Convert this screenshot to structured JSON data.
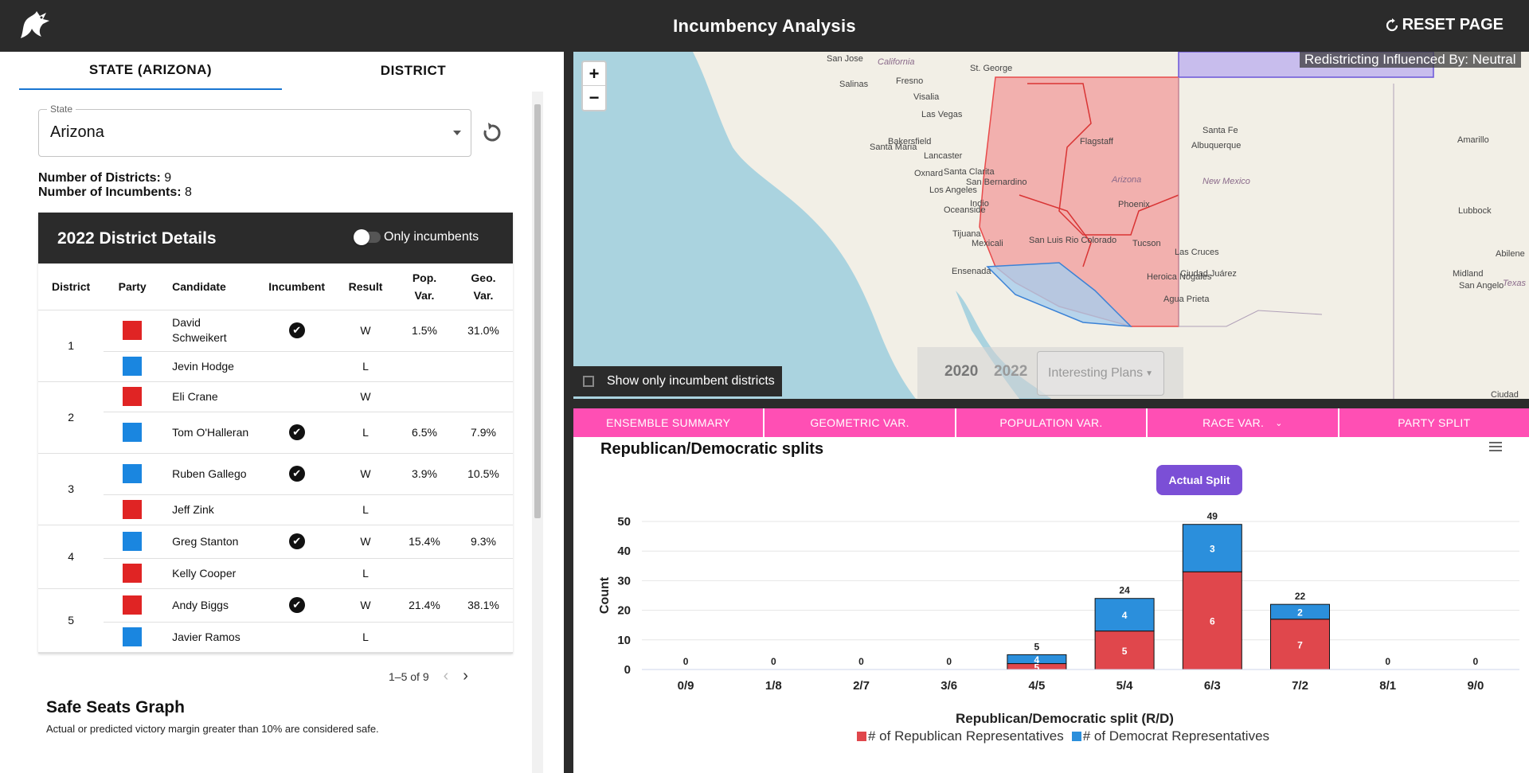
{
  "app": {
    "title": "Incumbency Analysis",
    "reset_label": "RESET PAGE"
  },
  "tabs": [
    {
      "label": "STATE (ARIZONA)",
      "active": true
    },
    {
      "label": "DISTRICT",
      "active": false
    }
  ],
  "state_select": {
    "legend": "State",
    "value": "Arizona"
  },
  "counts": {
    "districts_label": "Number of Districts:",
    "districts_value": "9",
    "incumbents_label": "Number of Incumbents:",
    "incumbents_value": "8"
  },
  "details": {
    "title": "2022 District Details",
    "toggle_label": "Only incumbents",
    "toggle_on": false,
    "columns": [
      "District",
      "Party",
      "Candidate",
      "Incumbent",
      "Result",
      "Pop. Var.",
      "Geo. Var."
    ],
    "rows": [
      {
        "district": "1",
        "party": "R",
        "candidate": "David Schweikert",
        "incumbent": true,
        "result": "W",
        "pop": "1.5%",
        "geo": "31.0%"
      },
      {
        "district": "1",
        "party": "D",
        "candidate": "Jevin Hodge",
        "incumbent": false,
        "result": "L",
        "pop": "",
        "geo": ""
      },
      {
        "district": "2",
        "party": "R",
        "candidate": "Eli Crane",
        "incumbent": false,
        "result": "W",
        "pop": "",
        "geo": ""
      },
      {
        "district": "2",
        "party": "D",
        "candidate": "Tom O'Halleran",
        "incumbent": true,
        "result": "L",
        "pop": "6.5%",
        "geo": "7.9%"
      },
      {
        "district": "3",
        "party": "D",
        "candidate": "Ruben Gallego",
        "incumbent": true,
        "result": "W",
        "pop": "3.9%",
        "geo": "10.5%"
      },
      {
        "district": "3",
        "party": "R",
        "candidate": "Jeff Zink",
        "incumbent": false,
        "result": "L",
        "pop": "",
        "geo": ""
      },
      {
        "district": "4",
        "party": "D",
        "candidate": "Greg Stanton",
        "incumbent": true,
        "result": "W",
        "pop": "15.4%",
        "geo": "9.3%"
      },
      {
        "district": "4",
        "party": "R",
        "candidate": "Kelly Cooper",
        "incumbent": false,
        "result": "L",
        "pop": "",
        "geo": ""
      },
      {
        "district": "5",
        "party": "R",
        "candidate": "Andy Biggs",
        "incumbent": true,
        "result": "W",
        "pop": "21.4%",
        "geo": "38.1%"
      },
      {
        "district": "5",
        "party": "D",
        "candidate": "Javier Ramos",
        "incumbent": false,
        "result": "L",
        "pop": "",
        "geo": ""
      }
    ],
    "pagination": "1–5 of 9"
  },
  "safe_seats": {
    "title": "Safe Seats Graph",
    "description": "Actual or predicted victory margin greater than 10% are considered safe."
  },
  "map": {
    "redistrict_label": "Redistricting Influenced By: Neutral",
    "incumbent_only_label": "Show only incumbent districts",
    "years": [
      "2020",
      "2022"
    ],
    "plans_label": "Interesting Plans",
    "place_labels": [
      {
        "name": "San Jose",
        "style": "city"
      },
      {
        "name": "Fresno",
        "style": "city"
      },
      {
        "name": "Salinas",
        "style": "city"
      },
      {
        "name": "Visalia",
        "style": "city"
      },
      {
        "name": "California",
        "style": "region"
      },
      {
        "name": "St. George",
        "style": "city"
      },
      {
        "name": "Las Vegas",
        "style": "city"
      },
      {
        "name": "Bakersfield",
        "style": "city"
      },
      {
        "name": "Santa Maria",
        "style": "city"
      },
      {
        "name": "Lancaster",
        "style": "city"
      },
      {
        "name": "Oxnard",
        "style": "city"
      },
      {
        "name": "Santa Clarita",
        "style": "city"
      },
      {
        "name": "San Bernardino",
        "style": "city"
      },
      {
        "name": "Los Angeles",
        "style": "city"
      },
      {
        "name": "Indio",
        "style": "city"
      },
      {
        "name": "Oceanside",
        "style": "city"
      },
      {
        "name": "Tijuana",
        "style": "city"
      },
      {
        "name": "Mexicali",
        "style": "city"
      },
      {
        "name": "Ensenada",
        "style": "city"
      },
      {
        "name": "San Luis Rio Colorado",
        "style": "city"
      },
      {
        "name": "Flagstaff",
        "style": "city"
      },
      {
        "name": "Arizona",
        "style": "region"
      },
      {
        "name": "Phoenix",
        "style": "city"
      },
      {
        "name": "Tucson",
        "style": "city"
      },
      {
        "name": "Heroica Nogales",
        "style": "city"
      },
      {
        "name": "Agua Prieta",
        "style": "city"
      },
      {
        "name": "Albuquerque",
        "style": "city"
      },
      {
        "name": "Santa Fe",
        "style": "city"
      },
      {
        "name": "New Mexico",
        "style": "region"
      },
      {
        "name": "Las Cruces",
        "style": "city"
      },
      {
        "name": "Ciudad Juárez",
        "style": "city"
      },
      {
        "name": "Amarillo",
        "style": "city"
      },
      {
        "name": "Lubbock",
        "style": "city"
      },
      {
        "name": "Midland",
        "style": "city"
      },
      {
        "name": "San Angelo",
        "style": "city"
      },
      {
        "name": "Abilene",
        "style": "city"
      },
      {
        "name": "Texas",
        "style": "region"
      },
      {
        "name": "Ciudad",
        "style": "city"
      }
    ]
  },
  "chart_tabs": [
    "ENSEMBLE SUMMARY",
    "GEOMETRIC VAR.",
    "POPULATION VAR.",
    "RACE VAR.",
    "PARTY SPLIT"
  ],
  "chart": {
    "title": "Republican/Democratic splits",
    "actual_split_label": "Actual Split"
  },
  "chart_data": {
    "type": "bar",
    "stacked": true,
    "title": "Republican/Democratic splits",
    "xlabel": "Republican/Democratic split (R/D)",
    "ylabel": "Count",
    "ylim": [
      0,
      50
    ],
    "yticks": [
      0,
      10,
      20,
      30,
      40,
      50
    ],
    "categories": [
      "0/9",
      "1/8",
      "2/7",
      "3/6",
      "4/5",
      "5/4",
      "6/3",
      "7/2",
      "8/1",
      "9/0"
    ],
    "totals": [
      0,
      0,
      0,
      0,
      5,
      24,
      49,
      22,
      0,
      0
    ],
    "series": [
      {
        "name": "# of Republican Representatives",
        "color": "#e0474c",
        "values": [
          0,
          0,
          0,
          0,
          2,
          13,
          33,
          17,
          0,
          0
        ],
        "labels": [
          "",
          "",
          "",
          "",
          "5",
          "5",
          "6",
          "7",
          "",
          ""
        ]
      },
      {
        "name": "# of Democrat Representatives",
        "color": "#2b8fdc",
        "values": [
          0,
          0,
          0,
          0,
          3,
          11,
          16,
          5,
          0,
          0
        ],
        "labels": [
          "",
          "",
          "",
          "",
          "4",
          "4",
          "3",
          "2",
          "",
          ""
        ]
      }
    ],
    "legend_position": "bottom"
  }
}
